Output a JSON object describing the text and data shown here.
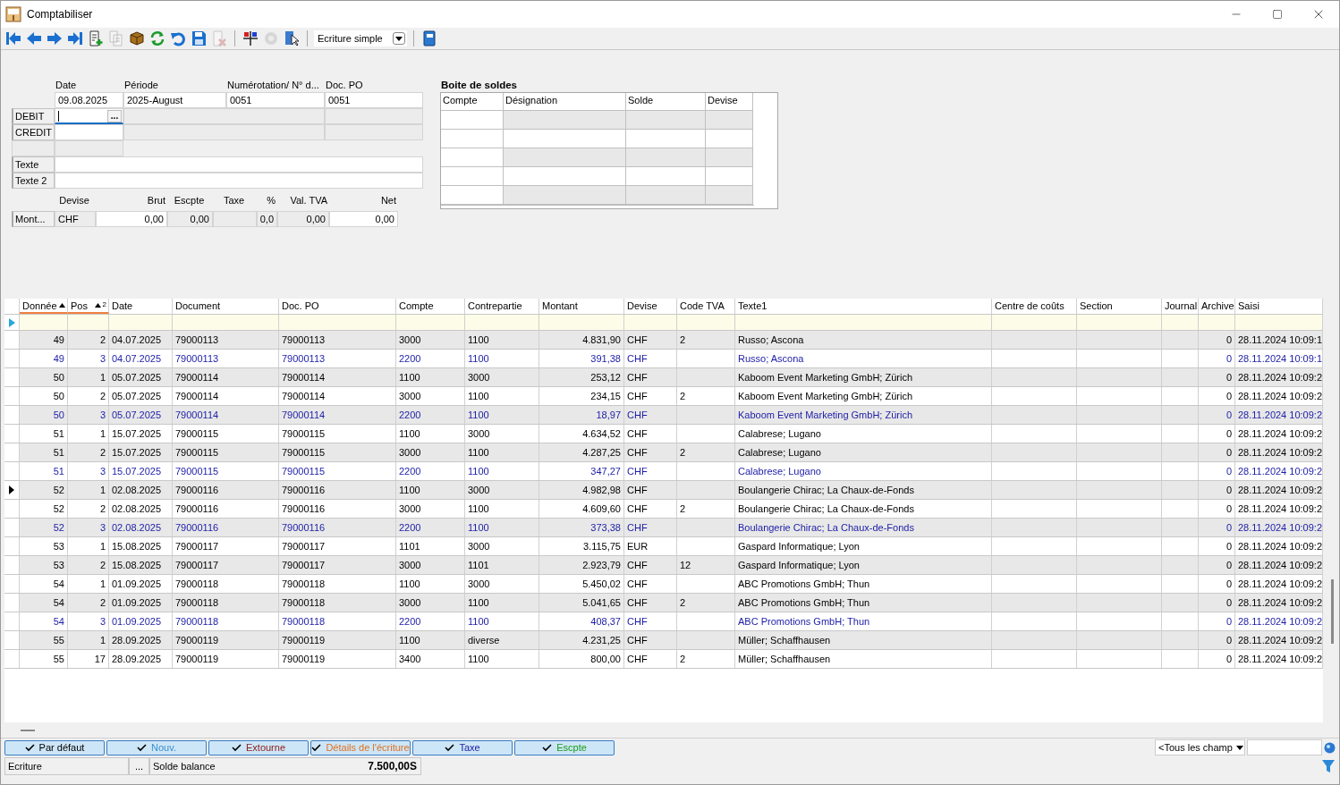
{
  "window": {
    "title": "Comptabiliser"
  },
  "toolbar": {
    "buttons": [
      {
        "kind": "first",
        "disabled": false
      },
      {
        "kind": "prev",
        "disabled": false
      },
      {
        "kind": "next",
        "disabled": false
      },
      {
        "kind": "last",
        "disabled": false
      },
      {
        "kind": "new",
        "disabled": false
      },
      {
        "kind": "copy",
        "disabled": true
      },
      {
        "kind": "box",
        "disabled": false
      },
      {
        "kind": "refresh",
        "disabled": false
      },
      {
        "kind": "undo",
        "disabled": false
      },
      {
        "kind": "save",
        "disabled": false
      },
      {
        "kind": "delete",
        "disabled": true
      },
      {
        "kind": "separator"
      },
      {
        "kind": "split",
        "disabled": false
      },
      {
        "kind": "gear",
        "disabled": true
      },
      {
        "kind": "pointer",
        "disabled": false
      },
      {
        "kind": "separator"
      },
      {
        "kind": "mode",
        "value": "Ecriture simple"
      },
      {
        "kind": "separator"
      },
      {
        "kind": "book",
        "disabled": false
      }
    ]
  },
  "form": {
    "date": {
      "label": "Date",
      "value": "09.08.2025"
    },
    "period": {
      "label": "Période",
      "value": "2025-August"
    },
    "numbering": {
      "label": "Numérotation/ N° d...",
      "value": "0051"
    },
    "doc_po": {
      "label": "Doc. PO",
      "value": "0051"
    },
    "debit": {
      "label": "DEBIT",
      "focused": true,
      "button": "..."
    },
    "credit": {
      "label": "CREDIT",
      "focused": false
    },
    "texte": {
      "label": "Texte"
    },
    "texte2": {
      "label": "Texte 2"
    },
    "amounts": {
      "row_label": "Mont...",
      "fields": [
        {
          "label": "Devise",
          "value": "CHF",
          "editable": false
        },
        {
          "label": "Brut",
          "value": "0,00",
          "editable": true
        },
        {
          "label": "Escpte",
          "value": "0,00",
          "editable": false
        },
        {
          "label": "Taxe",
          "editable": false
        },
        {
          "label": "%",
          "value": "0,0",
          "editable": false
        },
        {
          "label": "Val. TVA",
          "value": "0,00",
          "editable": false
        },
        {
          "label": "Net",
          "value": "0,00",
          "editable": true
        }
      ]
    }
  },
  "balance_box": {
    "title": "Boite de soldes",
    "columns": [
      "Compte",
      "Désignation",
      "Solde",
      "Devise"
    ]
  },
  "grid": {
    "columns": [
      {
        "label": "Donnée",
        "sorted": true
      },
      {
        "label": "Pos",
        "sorted": true,
        "sort_index": "2"
      },
      {
        "label": "Date",
        "sorted": false
      },
      {
        "label": "Document",
        "sorted": false
      },
      {
        "label": "Doc. PO",
        "sorted": false
      },
      {
        "label": "Compte",
        "sorted": false
      },
      {
        "label": "Contrepartie",
        "sorted": false
      },
      {
        "label": "Montant",
        "sorted": false
      },
      {
        "label": "Devise",
        "sorted": false
      },
      {
        "label": "Code TVA",
        "sorted": false
      },
      {
        "label": "Texte1",
        "sorted": false
      },
      {
        "label": "Centre de coûts",
        "sorted": false
      },
      {
        "label": "Section",
        "sorted": false
      },
      {
        "label": "Journal",
        "sorted": false
      },
      {
        "label": "Archive",
        "sorted": false
      },
      {
        "label": "Saisi",
        "sorted": false
      }
    ],
    "rows": [
      {
        "current": false,
        "kind": "entry",
        "cells": [
          "49",
          "2",
          "04.07.2025",
          "79000113",
          "79000113",
          "3000",
          "1100",
          "4.831,90",
          "CHF",
          "2",
          "Russo; Ascona",
          null,
          null,
          null,
          "0",
          "28.11.2024 10:09:1"
        ]
      },
      {
        "current": false,
        "kind": "tax",
        "cells": [
          "49",
          "3",
          "04.07.2025",
          "79000113",
          "79000113",
          "2200",
          "1100",
          "391,38",
          "CHF",
          null,
          "Russo; Ascona",
          null,
          null,
          null,
          "0",
          "28.11.2024 10:09:1"
        ]
      },
      {
        "current": false,
        "kind": "entry",
        "cells": [
          "50",
          "1",
          "05.07.2025",
          "79000114",
          "79000114",
          "1100",
          "3000",
          "253,12",
          "CHF",
          null,
          "Kaboom Event Marketing GmbH; Zürich",
          null,
          null,
          null,
          "0",
          "28.11.2024 10:09:2"
        ]
      },
      {
        "current": false,
        "kind": "entry",
        "cells": [
          "50",
          "2",
          "05.07.2025",
          "79000114",
          "79000114",
          "3000",
          "1100",
          "234,15",
          "CHF",
          "2",
          "Kaboom Event Marketing GmbH; Zürich",
          null,
          null,
          null,
          "0",
          "28.11.2024 10:09:2"
        ]
      },
      {
        "current": false,
        "kind": "tax",
        "cells": [
          "50",
          "3",
          "05.07.2025",
          "79000114",
          "79000114",
          "2200",
          "1100",
          "18,97",
          "CHF",
          null,
          "Kaboom Event Marketing GmbH; Zürich",
          null,
          null,
          null,
          "0",
          "28.11.2024 10:09:2"
        ]
      },
      {
        "current": false,
        "kind": "entry",
        "cells": [
          "51",
          "1",
          "15.07.2025",
          "79000115",
          "79000115",
          "1100",
          "3000",
          "4.634,52",
          "CHF",
          null,
          "Calabrese; Lugano",
          null,
          null,
          null,
          "0",
          "28.11.2024 10:09:2"
        ]
      },
      {
        "current": false,
        "kind": "entry",
        "cells": [
          "51",
          "2",
          "15.07.2025",
          "79000115",
          "79000115",
          "3000",
          "1100",
          "4.287,25",
          "CHF",
          "2",
          "Calabrese; Lugano",
          null,
          null,
          null,
          "0",
          "28.11.2024 10:09:2"
        ]
      },
      {
        "current": false,
        "kind": "tax",
        "cells": [
          "51",
          "3",
          "15.07.2025",
          "79000115",
          "79000115",
          "2200",
          "1100",
          "347,27",
          "CHF",
          null,
          "Calabrese; Lugano",
          null,
          null,
          null,
          "0",
          "28.11.2024 10:09:2"
        ]
      },
      {
        "current": true,
        "kind": "entry",
        "cells": [
          "52",
          "1",
          "02.08.2025",
          "79000116",
          "79000116",
          "1100",
          "3000",
          "4.982,98",
          "CHF",
          null,
          "Boulangerie Chirac; La Chaux-de-Fonds",
          null,
          null,
          null,
          "0",
          "28.11.2024 10:09:2"
        ]
      },
      {
        "current": false,
        "kind": "entry",
        "cells": [
          "52",
          "2",
          "02.08.2025",
          "79000116",
          "79000116",
          "3000",
          "1100",
          "4.609,60",
          "CHF",
          "2",
          "Boulangerie Chirac; La Chaux-de-Fonds",
          null,
          null,
          null,
          "0",
          "28.11.2024 10:09:2"
        ]
      },
      {
        "current": false,
        "kind": "tax",
        "cells": [
          "52",
          "3",
          "02.08.2025",
          "79000116",
          "79000116",
          "2200",
          "1100",
          "373,38",
          "CHF",
          null,
          "Boulangerie Chirac; La Chaux-de-Fonds",
          null,
          null,
          null,
          "0",
          "28.11.2024 10:09:2"
        ]
      },
      {
        "current": false,
        "kind": "entry",
        "cells": [
          "53",
          "1",
          "15.08.2025",
          "79000117",
          "79000117",
          "1101",
          "3000",
          "3.115,75",
          "EUR",
          null,
          "Gaspard Informatique; Lyon",
          null,
          null,
          null,
          "0",
          "28.11.2024 10:09:2"
        ]
      },
      {
        "current": false,
        "kind": "entry",
        "cells": [
          "53",
          "2",
          "15.08.2025",
          "79000117",
          "79000117",
          "3000",
          "1101",
          "2.923,79",
          "CHF",
          "12",
          "Gaspard Informatique; Lyon",
          null,
          null,
          null,
          "0",
          "28.11.2024 10:09:2"
        ]
      },
      {
        "current": false,
        "kind": "entry",
        "cells": [
          "54",
          "1",
          "01.09.2025",
          "79000118",
          "79000118",
          "1100",
          "3000",
          "5.450,02",
          "CHF",
          null,
          "ABC Promotions GmbH; Thun",
          null,
          null,
          null,
          "0",
          "28.11.2024 10:09:2"
        ]
      },
      {
        "current": false,
        "kind": "entry",
        "cells": [
          "54",
          "2",
          "01.09.2025",
          "79000118",
          "79000118",
          "3000",
          "1100",
          "5.041,65",
          "CHF",
          "2",
          "ABC Promotions GmbH; Thun",
          null,
          null,
          null,
          "0",
          "28.11.2024 10:09:2"
        ]
      },
      {
        "current": false,
        "kind": "tax",
        "cells": [
          "54",
          "3",
          "01.09.2025",
          "79000118",
          "79000118",
          "2200",
          "1100",
          "408,37",
          "CHF",
          null,
          "ABC Promotions GmbH; Thun",
          null,
          null,
          null,
          "0",
          "28.11.2024 10:09:2"
        ]
      },
      {
        "current": false,
        "kind": "entry",
        "cells": [
          "55",
          "1",
          "28.09.2025",
          "79000119",
          "79000119",
          "1100",
          "diverse",
          "4.231,25",
          "CHF",
          null,
          "Müller; Schaffhausen",
          null,
          null,
          null,
          "0",
          "28.11.2024 10:09:2"
        ]
      },
      {
        "current": false,
        "kind": "entry",
        "cells": [
          "55",
          "17",
          "28.09.2025",
          "79000119",
          "79000119",
          "3400",
          "1100",
          "800,00",
          "CHF",
          "2",
          "Müller; Schaffhausen",
          null,
          null,
          null,
          "0",
          "28.11.2024 10:09:2"
        ]
      }
    ]
  },
  "filter_buttons": [
    {
      "label": "Par défaut",
      "checked": true,
      "color": "#000000"
    },
    {
      "label": "Nouv.",
      "checked": true,
      "color": "#3a8fd0"
    },
    {
      "label": "Extourne",
      "checked": true,
      "color": "#8b1a1a"
    },
    {
      "label": "Détails de l'écriture",
      "checked": true,
      "color": "#e07020"
    },
    {
      "label": "Taxe",
      "checked": true,
      "color": "#1a1aa0"
    },
    {
      "label": "Escpte",
      "checked": true,
      "color": "#1a9a1a"
    }
  ],
  "field_select": {
    "value": "<Tous les champ"
  },
  "status_bar": {
    "mode": "Ecriture",
    "more": "...",
    "balance_label": "Solde balance",
    "balance_value": "7.500,00S"
  }
}
